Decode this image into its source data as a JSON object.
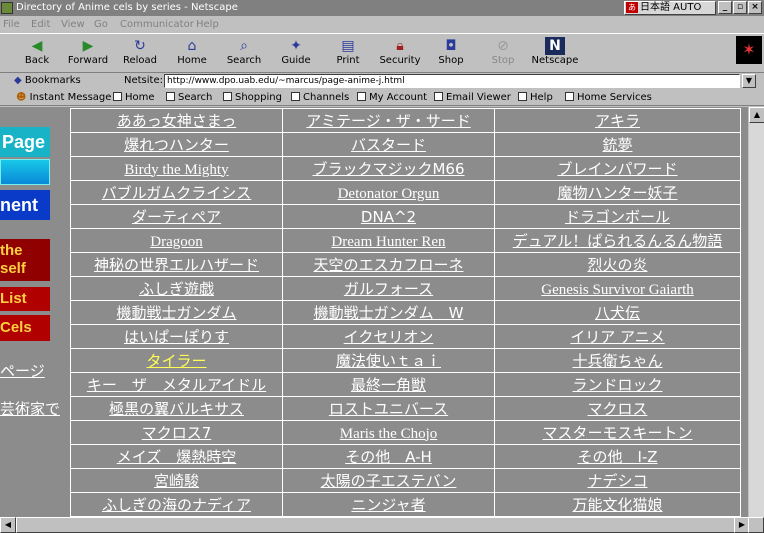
{
  "window": {
    "title": "Directory of Anime cels by series - Netscape",
    "ime_label": "日本語 AUTO"
  },
  "menu": [
    "File",
    "Edit",
    "View",
    "Go",
    "Communicator",
    "Help"
  ],
  "toolbar": [
    {
      "label": "Back",
      "icon": "back-arrow-icon"
    },
    {
      "label": "Forward",
      "icon": "forward-arrow-icon"
    },
    {
      "label": "Reload",
      "icon": "reload-icon"
    },
    {
      "label": "Home",
      "icon": "home-icon"
    },
    {
      "label": "Search",
      "icon": "search-icon"
    },
    {
      "label": "Guide",
      "icon": "guide-icon"
    },
    {
      "label": "Print",
      "icon": "print-icon"
    },
    {
      "label": "Security",
      "icon": "security-lock-icon"
    },
    {
      "label": "Shop",
      "icon": "shop-icon"
    },
    {
      "label": "Stop",
      "icon": "stop-icon"
    },
    {
      "label": "Netscape",
      "icon": "netscape-n-icon"
    }
  ],
  "location": {
    "bookmarks_label": "Bookmarks",
    "field_label": "Netsite:",
    "url": "http://www.dpo.uab.edu/~marcus/page-anime-j.html"
  },
  "personal_toolbar": [
    "Instant Message",
    "Home",
    "Search",
    "Shopping",
    "Channels",
    "My Account",
    "Email Viewer",
    "Help",
    "Home Services"
  ],
  "left_nav": {
    "buttons": [
      "Page",
      "",
      "nent",
      "the\nself",
      "List",
      "Cels"
    ],
    "links": [
      "ページ",
      "芸術家で"
    ]
  },
  "series_grid": [
    [
      "ああっ女神さまっ",
      "アミテージ・ザ・サード",
      "アキラ"
    ],
    [
      "爆れつハンター",
      "バスタード",
      "銃夢"
    ],
    [
      "Birdy the Mighty",
      "ブラックマジックM66",
      "ブレインパワード"
    ],
    [
      "バブルガムクライシス",
      "Detonator Orgun",
      "魔物ハンター妖子"
    ],
    [
      "ダーティペア",
      "DNA^2",
      "ドラゴンボール"
    ],
    [
      "Dragoon",
      "Dream Hunter Ren",
      "デュアル！ぱられるんるん物語"
    ],
    [
      "神秘の世界エルハザード",
      "天空のエスカフローネ",
      "烈火の炎"
    ],
    [
      "ふしぎ遊戯",
      "ガルフォース",
      "Genesis Survivor Gaiarth"
    ],
    [
      "機動戦士ガンダム",
      "機動戦士ガンダム　W",
      "八犬伝"
    ],
    [
      "はいぱーぽりす",
      "イクセリオン",
      "イリア アニメ"
    ],
    [
      "タイラー",
      "魔法使いｔａｉ",
      "十兵衛ちゃん"
    ],
    [
      "キー　ザ　メタルアイドル",
      "最終一角獣",
      "ランドロック"
    ],
    [
      "極黒の翼バルキサス",
      "ロストユニバース",
      "マクロス"
    ],
    [
      "マクロス7",
      "Maris the Chojo",
      "マスターモスキートン"
    ],
    [
      "メイズ　爆熱時空",
      "その他　A-H",
      "その他　I-Z"
    ],
    [
      "宮崎駿",
      "太陽の子エステバン",
      "ナデシコ"
    ],
    [
      "ふしぎの海のナディア",
      "ニンジャ者",
      "万能文化猫娘"
    ]
  ],
  "colors": {
    "content_bg": "#8c8c8c",
    "link": "#ffffff",
    "visited_link": "#ffff55",
    "nav_cyan": "#19b3c8",
    "nav_blue": "#0a3ac8",
    "nav_red": "#b00000"
  }
}
